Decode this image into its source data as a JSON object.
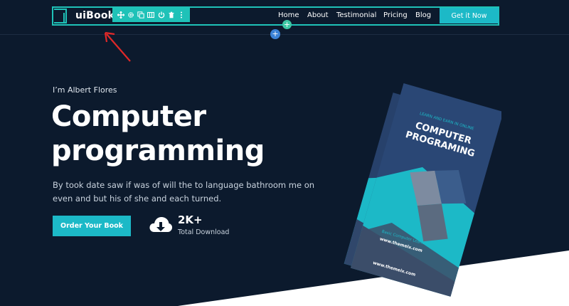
{
  "header": {
    "logo": "uiBook",
    "nav": [
      "Home",
      "About",
      "Testimonial",
      "Pricing",
      "Blog"
    ],
    "cta": "Get it Now"
  },
  "editor": {
    "toolbar_icons": [
      "move-icon",
      "settings-icon",
      "duplicate-icon",
      "columns-icon",
      "power-icon",
      "delete-icon",
      "more-icon"
    ],
    "add_section_green": "+",
    "add_section_blue": "+"
  },
  "hero": {
    "intro": "I’m Albert Flores",
    "title_line1": "Computer",
    "title_line2": "programming",
    "description": "By took date saw if was of will the to language bathroom me on even and but his of she and each turned.",
    "order_button": "Order Your Book",
    "download_count": "2K+",
    "download_label": "Total Download"
  },
  "book": {
    "tagline": "LEARN AND EARN IN ONLINE",
    "title_line1": "COMPUTER",
    "title_line2": "PROGRAMING",
    "subtitle": "Basic Computer Learn",
    "url": "www.themeix.com"
  },
  "colors": {
    "background": "#0c1a2d",
    "accent": "#1cb9c7",
    "editor_frame": "#1fc2b8",
    "book_cover": "#2a4775"
  }
}
